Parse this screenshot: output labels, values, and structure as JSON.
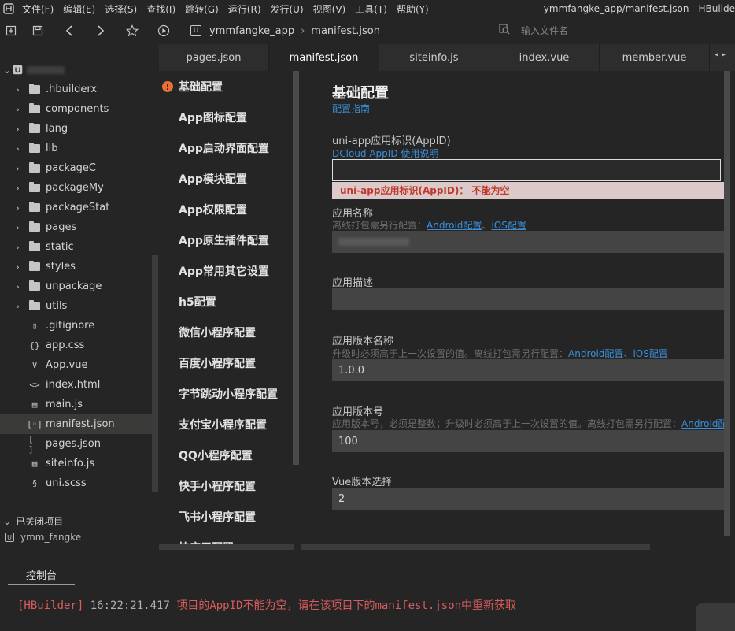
{
  "menubar": {
    "items": [
      "文件(F)",
      "编辑(E)",
      "选择(S)",
      "查找(I)",
      "跳转(G)",
      "运行(R)",
      "发行(U)",
      "视图(V)",
      "工具(T)",
      "帮助(Y)"
    ],
    "window_title": "ymmfangke_app/manifest.json - HBuilde"
  },
  "toolbar": {
    "breadcrumb_project": "ymmfangke_app",
    "breadcrumb_file": "manifest.json",
    "search_placeholder": "输入文件名"
  },
  "sidebar": {
    "items": [
      {
        "label": "",
        "kind": "project",
        "expanded": true
      },
      {
        "label": ".hbuilderx",
        "kind": "folder"
      },
      {
        "label": "components",
        "kind": "folder"
      },
      {
        "label": "lang",
        "kind": "folder"
      },
      {
        "label": "lib",
        "kind": "folder"
      },
      {
        "label": "packageC",
        "kind": "folder"
      },
      {
        "label": "packageMy",
        "kind": "folder"
      },
      {
        "label": "packageStat",
        "kind": "folder"
      },
      {
        "label": "pages",
        "kind": "folder"
      },
      {
        "label": "static",
        "kind": "folder"
      },
      {
        "label": "styles",
        "kind": "folder"
      },
      {
        "label": "unpackage",
        "kind": "folder"
      },
      {
        "label": "utils",
        "kind": "folder"
      },
      {
        "label": ".gitignore",
        "kind": "file",
        "icon": "▯"
      },
      {
        "label": "app.css",
        "kind": "file",
        "icon": "{}"
      },
      {
        "label": "App.vue",
        "kind": "file",
        "icon": "V"
      },
      {
        "label": "index.html",
        "kind": "file",
        "icon": "<>"
      },
      {
        "label": "main.js",
        "kind": "file",
        "icon": "▤"
      },
      {
        "label": "manifest.json",
        "kind": "file",
        "icon": "[◦]",
        "selected": true
      },
      {
        "label": "pages.json",
        "kind": "file",
        "icon": "[ ]"
      },
      {
        "label": "siteinfo.js",
        "kind": "file",
        "icon": "▤"
      },
      {
        "label": "uni.scss",
        "kind": "file",
        "icon": "§"
      }
    ],
    "closed_projects_header": "已关闭项目",
    "closed_project": "ymm_fangke"
  },
  "tabs": [
    "pages.json",
    "manifest.json",
    "siteinfo.js",
    "index.vue",
    "member.vue"
  ],
  "active_tab": 1,
  "secnav": {
    "items": [
      "基础配置",
      "App图标配置",
      "App启动界面配置",
      "App模块配置",
      "App权限配置",
      "App原生插件配置",
      "App常用其它设置",
      "h5配置",
      "微信小程序配置",
      "百度小程序配置",
      "字节跳动小程序配置",
      "支付宝小程序配置",
      "QQ小程序配置",
      "快手小程序配置",
      "飞书小程序配置",
      "快应用配置"
    ]
  },
  "form": {
    "title": "基础配置",
    "guide_link": "配置指南",
    "appid_label": "uni-app应用标识(AppID)",
    "appid_link": "DCloud AppID 使用说明",
    "appid_value": "",
    "appid_error": "uni-app应用标识(AppID)：  不能为空",
    "name_label": "应用名称",
    "name_hint": "离线打包需另行配置：",
    "android_link": "Android配置",
    "sep": "、",
    "ios_link": "iOS配置",
    "name_value": "",
    "desc_label": "应用描述",
    "desc_value": "",
    "vname_label": "应用版本名称",
    "vname_hint": "升级时必须高于上一次设置的值。离线打包需另行配置：",
    "vname_value": "1.0.0",
    "vcode_label": "应用版本号",
    "vcode_hint": "应用版本号，必须是整数；升级时必须高于上一次设置的值。离线打包需另行配置：",
    "vcode_android_link": "Android配",
    "vcode_value": "100",
    "vue_label": "Vue版本选择",
    "vue_value": "2"
  },
  "console": {
    "tab_label": "控制台",
    "prefix": "[HBuilder]",
    "time": "16:22:21.417",
    "message": "项目的AppID不能为空，请在该项目下的manifest.json中重新获取"
  },
  "colors": {
    "accent_link": "#3b8fd9",
    "error_text": "#c0392b",
    "error_bg": "#dcc9c9",
    "warning": "#e86f36"
  }
}
